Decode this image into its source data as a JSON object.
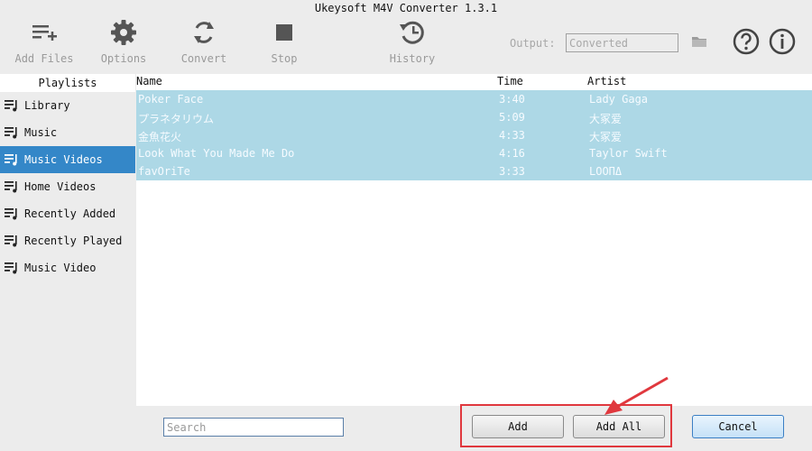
{
  "window": {
    "title": "Ukeysoft M4V Converter 1.3.1"
  },
  "toolbar": {
    "add_files": "Add Files",
    "options": "Options",
    "convert": "Convert",
    "stop": "Stop",
    "history": "History",
    "output_label": "Output:",
    "output_value": "Converted"
  },
  "sidebar": {
    "header": "Playlists",
    "items": [
      {
        "label": "Library"
      },
      {
        "label": "Music"
      },
      {
        "label": "Music Videos",
        "active": true
      },
      {
        "label": "Home Videos"
      },
      {
        "label": "Recently Added"
      },
      {
        "label": "Recently Played"
      },
      {
        "label": "Music Video"
      }
    ]
  },
  "table": {
    "columns": {
      "name": "Name",
      "time": "Time",
      "artist": "Artist"
    },
    "rows": [
      {
        "name": "Poker Face",
        "time": "3:40",
        "artist": "Lady Gaga"
      },
      {
        "name": "プラネタリウム",
        "time": "5:09",
        "artist": "大冢爱"
      },
      {
        "name": "金魚花火",
        "time": "4:33",
        "artist": "大冢爱"
      },
      {
        "name": "Look What You Made Me Do",
        "time": "4:16",
        "artist": "Taylor Swift"
      },
      {
        "name": "favOriTe",
        "time": "3:33",
        "artist": "LOOΠΔ"
      }
    ]
  },
  "bottom": {
    "search_placeholder": "Search",
    "add": "Add",
    "add_all": "Add All",
    "cancel": "Cancel"
  },
  "colors": {
    "selection": "#add8e6",
    "sidebar_active": "#3487c8",
    "annotation": "#e0383e"
  }
}
